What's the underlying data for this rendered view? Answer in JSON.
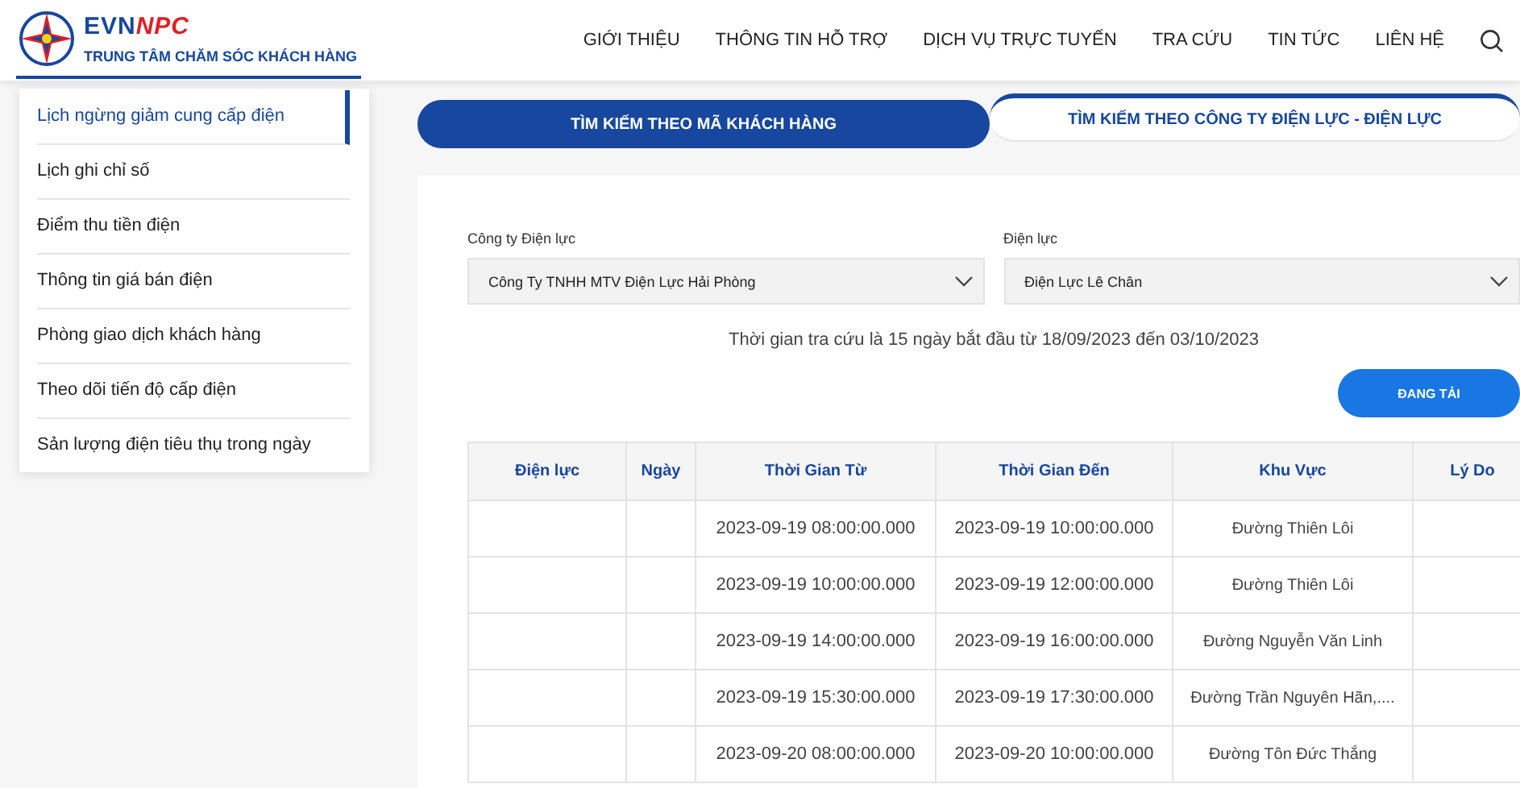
{
  "header": {
    "logo": {
      "brand": "EVN",
      "brand_accent": "NPC",
      "subtitle": "TRUNG TÂM CHĂM SÓC KHÁCH HÀNG"
    },
    "nav": [
      "GIỚI THIỆU",
      "THÔNG TIN HỖ TRỢ",
      "DỊCH VỤ TRỰC TUYẾN",
      "TRA CỨU",
      "TIN TỨC",
      "LIÊN HỆ"
    ]
  },
  "sidebar": {
    "items": [
      {
        "label": "Lịch ngừng giảm cung cấp điện",
        "selected": true
      },
      {
        "label": "Lịch ghi chỉ số",
        "selected": false
      },
      {
        "label": "Điểm thu tiền điện",
        "selected": false
      },
      {
        "label": "Thông tin giá bán điện",
        "selected": false
      },
      {
        "label": "Phòng giao dịch khách hàng",
        "selected": false
      },
      {
        "label": "Theo dõi tiến độ cấp điện",
        "selected": false
      },
      {
        "label": "Sản lượng điện tiêu thụ trong ngày",
        "selected": false
      }
    ]
  },
  "tabs": [
    {
      "label": "TÌM KIẾM THEO MÃ KHÁCH HÀNG",
      "selected": true
    },
    {
      "label": "TÌM KIẾM THEO CÔNG TY ĐIỆN LỰC - ĐIỆN LỰC",
      "selected": false
    }
  ],
  "filters": [
    {
      "label": "Công ty Điện lực",
      "value": "Công Ty TNHH MTV Điện Lực Hải Phòng"
    },
    {
      "label": "Điện lực",
      "value": "Điện Lực Lê Chân"
    }
  ],
  "info": "Thời gian tra cứu là 15 ngày bắt đầu từ 18/09/2023 đến 03/10/2023",
  "button": "ĐANG TẢI",
  "table": {
    "columns": [
      "Điện lực",
      "Ngày",
      "Thời Gian Từ",
      "Thời Gian Đến",
      "Khu Vực",
      "Lý Do"
    ],
    "rows": [
      {
        "from": "2023-09-19 08:00:00.000",
        "to": "2023-09-19 10:00:00.000",
        "area": "Đường Thiên Lôi"
      },
      {
        "from": "2023-09-19 10:00:00.000",
        "to": "2023-09-19 12:00:00.000",
        "area": "Đường Thiên Lôi"
      },
      {
        "from": "2023-09-19 14:00:00.000",
        "to": "2023-09-19 16:00:00.000",
        "area": "Đường Nguyễn Văn Linh"
      },
      {
        "from": "2023-09-19 15:30:00.000",
        "to": "2023-09-19 17:30:00.000",
        "area": "Đường Trần Nguyên Hãn,...."
      },
      {
        "from": "2023-09-20 08:00:00.000",
        "to": "2023-09-20 10:00:00.000",
        "area": "Đường Tôn Đức Thắng"
      }
    ]
  }
}
